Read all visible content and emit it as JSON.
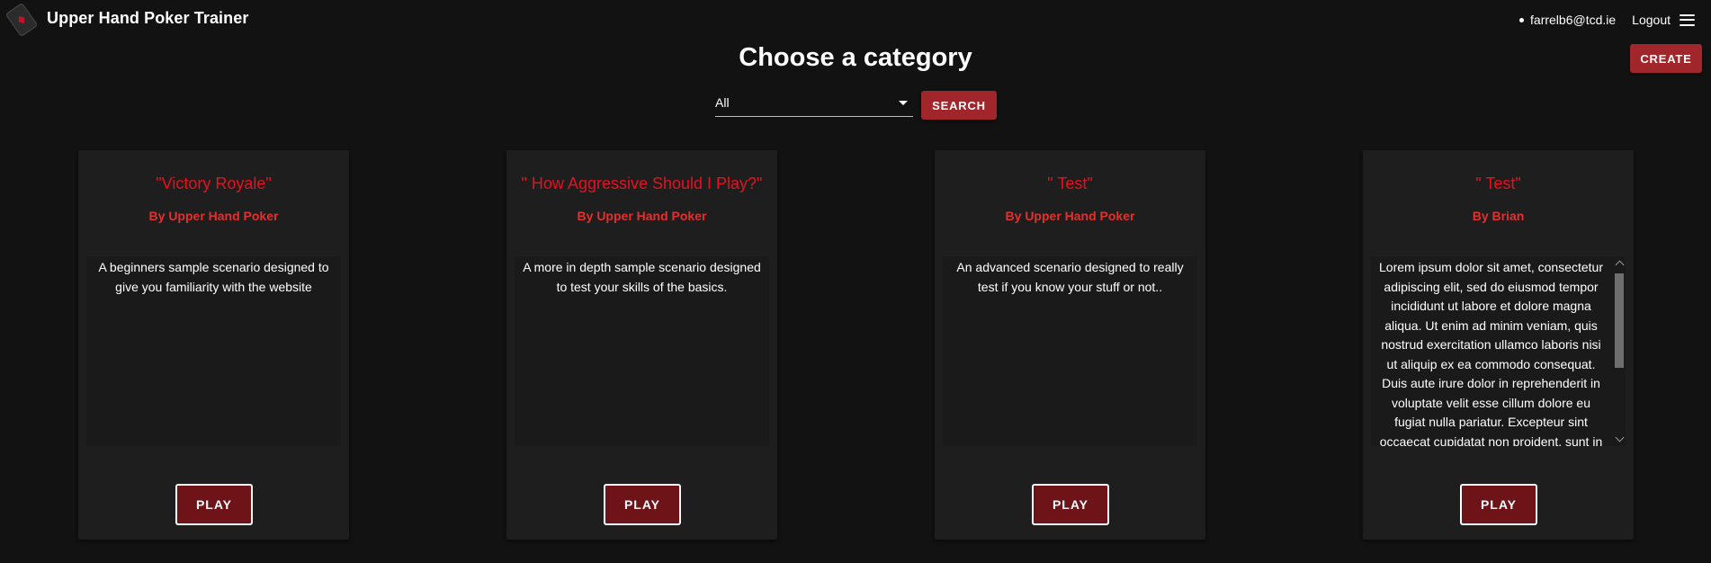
{
  "header": {
    "app_title": "Upper Hand Poker Trainer",
    "logo_icon": "poker-card-logo-icon",
    "user_email": "farrelb6@tcd.ie",
    "logout_label": "Logout",
    "menu_icon": "hamburger-menu-icon"
  },
  "page": {
    "title": "Choose a category",
    "create_label": "CREATE"
  },
  "filter": {
    "selected": "All",
    "search_label": "SEARCH"
  },
  "cards": [
    {
      "title": "\"Victory Royale\"",
      "author": "By Upper Hand Poker",
      "description": "A beginners sample scenario designed to give you familiarity with the website",
      "play_label": "PLAY"
    },
    {
      "title": "\" How Aggressive Should I Play?\"",
      "author": "By Upper Hand Poker",
      "description": "A more in depth sample scenario designed to test your skills of the basics.",
      "play_label": "PLAY"
    },
    {
      "title": "\" Test\"",
      "author": "By Upper Hand Poker",
      "description": "An advanced scenario designed to really test if you know your stuff or not..",
      "play_label": "PLAY"
    },
    {
      "title": "\" Test\"",
      "author": "By Brian",
      "description": "Lorem ipsum dolor sit amet, consectetur adipiscing elit, sed do eiusmod tempor incididunt ut labore et dolore magna aliqua. Ut enim ad minim veniam, quis nostrud exercitation ullamco laboris nisi ut aliquip ex ea commodo consequat. Duis aute irure dolor in reprehenderit in voluptate velit esse cillum dolore eu fugiat nulla pariatur. Excepteur sint occaecat cupidatat non proident, sunt in",
      "play_label": "PLAY"
    }
  ],
  "colors": {
    "background": "#121212",
    "card": "#1e1e1e",
    "accent_button": "#a1262b",
    "play_button": "#6e1419",
    "card_title": "#e8101f",
    "card_author": "#e2302f"
  }
}
